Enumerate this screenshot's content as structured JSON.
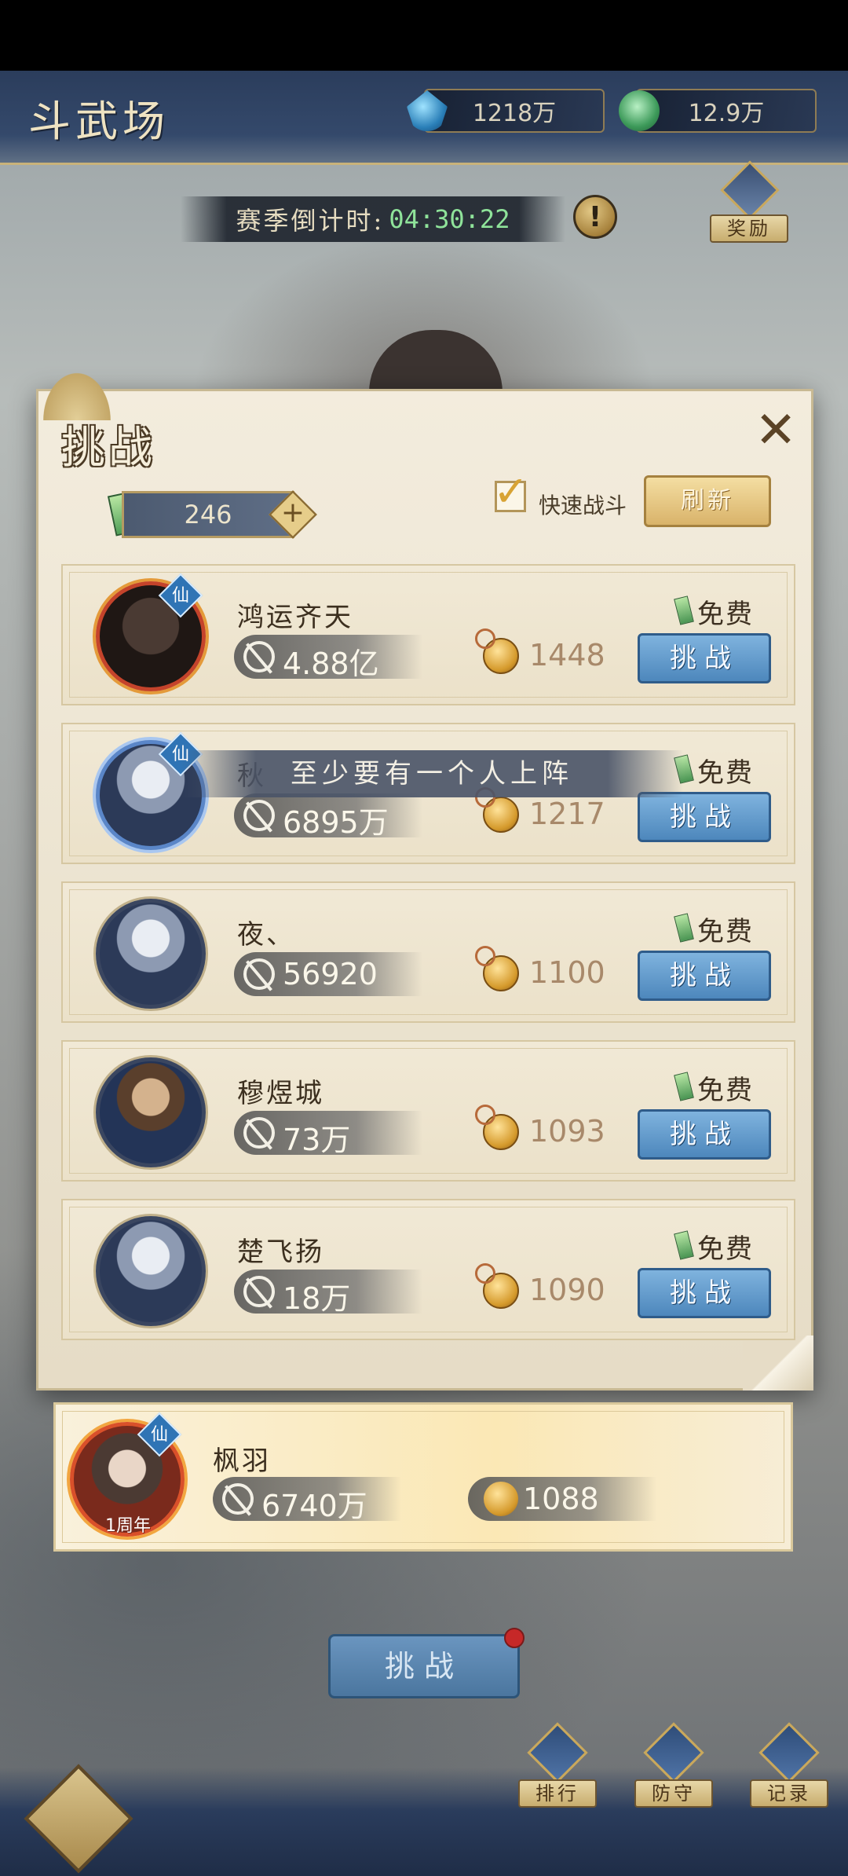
{
  "header": {
    "title": "斗武场",
    "currency_crystal": "1218万",
    "currency_jade": "12.9万"
  },
  "season": {
    "label": "赛季倒计时:",
    "countdown": "04:30:22",
    "info_glyph": "!"
  },
  "reward": {
    "label": "奖励"
  },
  "panel": {
    "title": "挑战",
    "close_glyph": "✕",
    "tokens": "246",
    "plus_glyph": "+",
    "quick_battle_checked": true,
    "quick_battle_label": "快速战斗",
    "refresh_label": "刷新"
  },
  "opponents": [
    {
      "name": "鸿运齐天",
      "power": "4.88亿",
      "score": "1448",
      "cost": "免费",
      "challenge": "挑战",
      "badge": "仙"
    },
    {
      "name": "秋",
      "power": "6895万",
      "score": "1217",
      "cost": "免费",
      "challenge": "挑战",
      "badge": "仙"
    },
    {
      "name": "夜、",
      "power": "56920",
      "score": "1100",
      "cost": "免费",
      "challenge": "挑战",
      "badge": ""
    },
    {
      "name": "穆煜城",
      "power": "73万",
      "score": "1093",
      "cost": "免费",
      "challenge": "挑战",
      "badge": ""
    },
    {
      "name": "楚飞扬",
      "power": "18万",
      "score": "1090",
      "cost": "免费",
      "challenge": "挑战",
      "badge": ""
    }
  ],
  "toast": "至少要有一个人上阵",
  "me": {
    "name": "枫羽",
    "power": "6740万",
    "score": "1088",
    "badge": "仙",
    "avatar_tag": "1周年"
  },
  "main_challenge": "挑战",
  "nav": {
    "rank": "排行",
    "defense": "防守",
    "record": "记录"
  }
}
